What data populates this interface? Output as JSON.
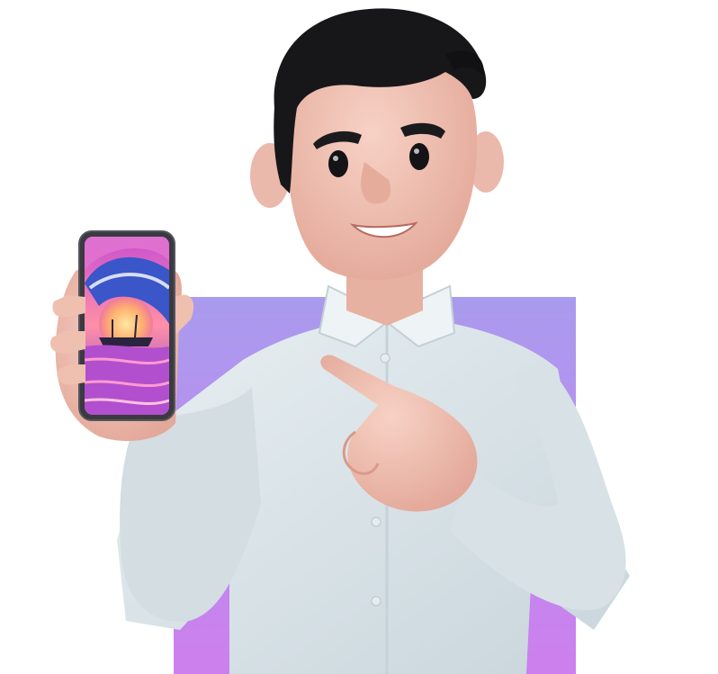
{
  "scene": {
    "description_icon": "man-pointing-at-phone-illustration",
    "colors": {
      "background": "#ffffff",
      "backdrop_top": "#a99bee",
      "backdrop_bottom": "#cd7fee",
      "skin": "#f2c4b5",
      "skin_shadow": "#e2a898",
      "hair": "#17171a",
      "shirt": "#dfe8ec",
      "shirt_shadow": "#c3d0d6",
      "phone_frame": "#3a3a40",
      "screen_sky": "#e85fc0",
      "screen_wave": "#3a56c8",
      "screen_sun": "#ffb070"
    }
  }
}
